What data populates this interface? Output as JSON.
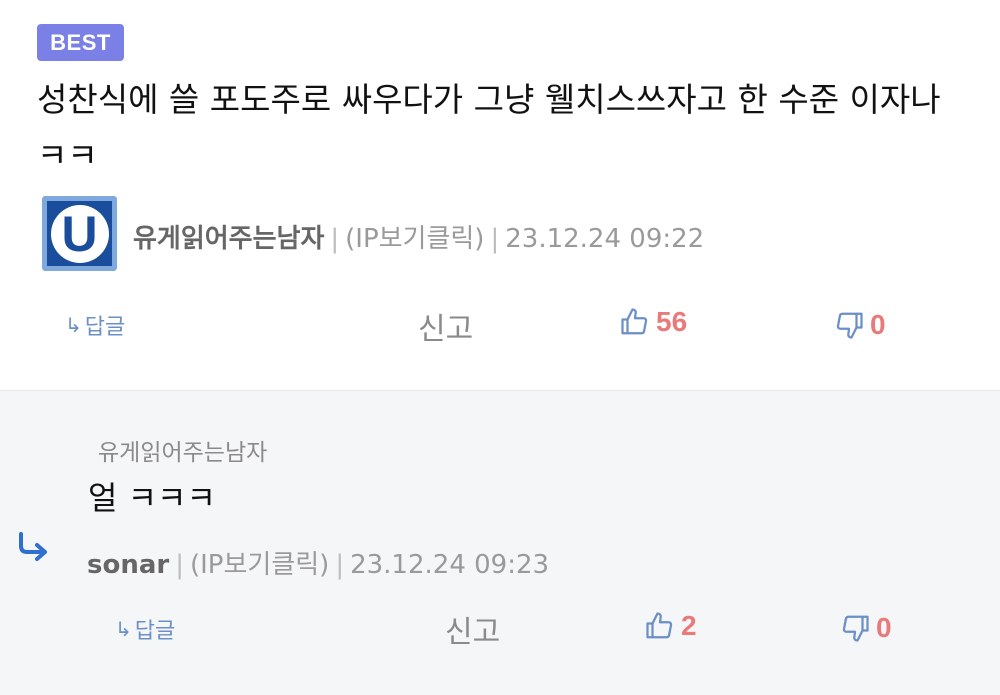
{
  "comment": {
    "badge": "BEST",
    "text": "성찬식에 쓸 포도주로 싸우다가 그냥 웰치스쓰자고 한 수준 이자나 ㅋㅋ",
    "avatar_letter": "U",
    "author": "유게읽어주는남자",
    "ip": "(IP보기클릭)",
    "date": "23.12.24 09:22",
    "actions": {
      "reply_label": "답글",
      "report_label": "신고",
      "likes": "56",
      "dislikes": "0"
    }
  },
  "reply": {
    "reply_to": "유게읽어주는남자",
    "text": "얼 ㅋㅋㅋ",
    "author": "sonar",
    "ip": "(IP보기클릭)",
    "date": "23.12.24 09:23",
    "actions": {
      "reply_label": "답글",
      "report_label": "신고",
      "likes": "2",
      "dislikes": "0"
    }
  },
  "colors": {
    "badge": "#7a80e6",
    "accent_blue": "#6b8fc7",
    "count_red": "#e87a7a"
  },
  "icons": [
    "reply-arrow-icon",
    "thumbs-up-icon",
    "thumbs-down-icon"
  ]
}
